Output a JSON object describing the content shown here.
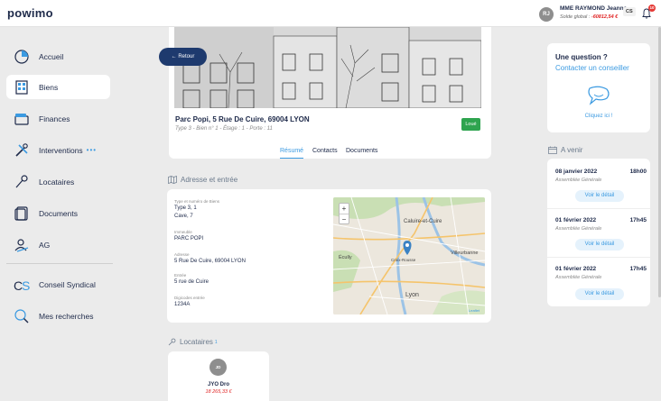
{
  "app": {
    "logo": "powimo"
  },
  "user": {
    "avatar_initials": "RJ",
    "name": "MME RAYMOND Jeanne",
    "balance_label": "Solde global : ",
    "balance_value": "-60812,54 €",
    "company_initials": "CS",
    "notification_count": "10"
  },
  "sidebar": {
    "items": [
      {
        "label": "Accueil",
        "icon": "home-icon"
      },
      {
        "label": "Biens",
        "icon": "building-icon"
      },
      {
        "label": "Finances",
        "icon": "wallet-icon"
      },
      {
        "label": "Interventions",
        "icon": "tools-icon",
        "extra": "•••"
      },
      {
        "label": "Locataires",
        "icon": "key-icon"
      },
      {
        "label": "Documents",
        "icon": "document-icon"
      },
      {
        "label": "AG",
        "icon": "meeting-icon"
      },
      {
        "label": "Conseil Syndical",
        "icon": "cs-icon"
      },
      {
        "label": "Mes recherches",
        "icon": "search-icon"
      }
    ]
  },
  "property": {
    "back_label": "← Retour",
    "title": "Parc Popi, 5 Rue De Cuire, 69004 LYON",
    "subtitle": "Type 3 - Bien n° 1 - Étage : 1 - Porte : 11",
    "status": "Loué",
    "tabs": [
      "Résumé",
      "Contacts",
      "Documents"
    ]
  },
  "address_section": {
    "title": "Adresse et entrée",
    "fields": [
      {
        "label": "Type et numéro de Biens",
        "values": [
          "Type 3, 1",
          "Cave, 7"
        ]
      },
      {
        "label": "Immeuble",
        "values": [
          "PARC POPI"
        ]
      },
      {
        "label": "Adresse",
        "values": [
          "5 Rue De Cuire, 69004 LYON"
        ]
      },
      {
        "label": "Entrée",
        "values": [
          "5 rue de Cuire"
        ]
      },
      {
        "label": "Digicodes entrée",
        "values": [
          "1234A"
        ]
      }
    ],
    "map": {
      "zoom_in": "+",
      "zoom_out": "−",
      "attribution": "Leaflet",
      "labels": [
        "Caluire-et-Cuire",
        "Villeurbanne",
        "Lyon",
        "Écully",
        "Croix-Rousse"
      ]
    }
  },
  "tenants_section": {
    "title": "Locataires",
    "count": "1",
    "tenants": [
      {
        "initials": "JD",
        "name": "JYO Dro",
        "amount": "18 265,33 €"
      }
    ]
  },
  "help": {
    "title": "Une question ?",
    "subtitle": "Contacter un conseiller",
    "link": "Cliquez ici !"
  },
  "upcoming": {
    "title": "A venir",
    "button_label": "Voir le détail",
    "events": [
      {
        "date": "08 janvier 2022",
        "time": "18h00",
        "type": "Assemblée Générale"
      },
      {
        "date": "01 février 2022",
        "time": "17h45",
        "type": "Assemblée Générale"
      },
      {
        "date": "01 février 2022",
        "time": "17h45",
        "type": "Assemblée Générale"
      }
    ]
  },
  "colors": {
    "primary": "#1e2a4a",
    "accent": "#3b9ae1",
    "success": "#2ea44f",
    "danger": "#e02424"
  }
}
